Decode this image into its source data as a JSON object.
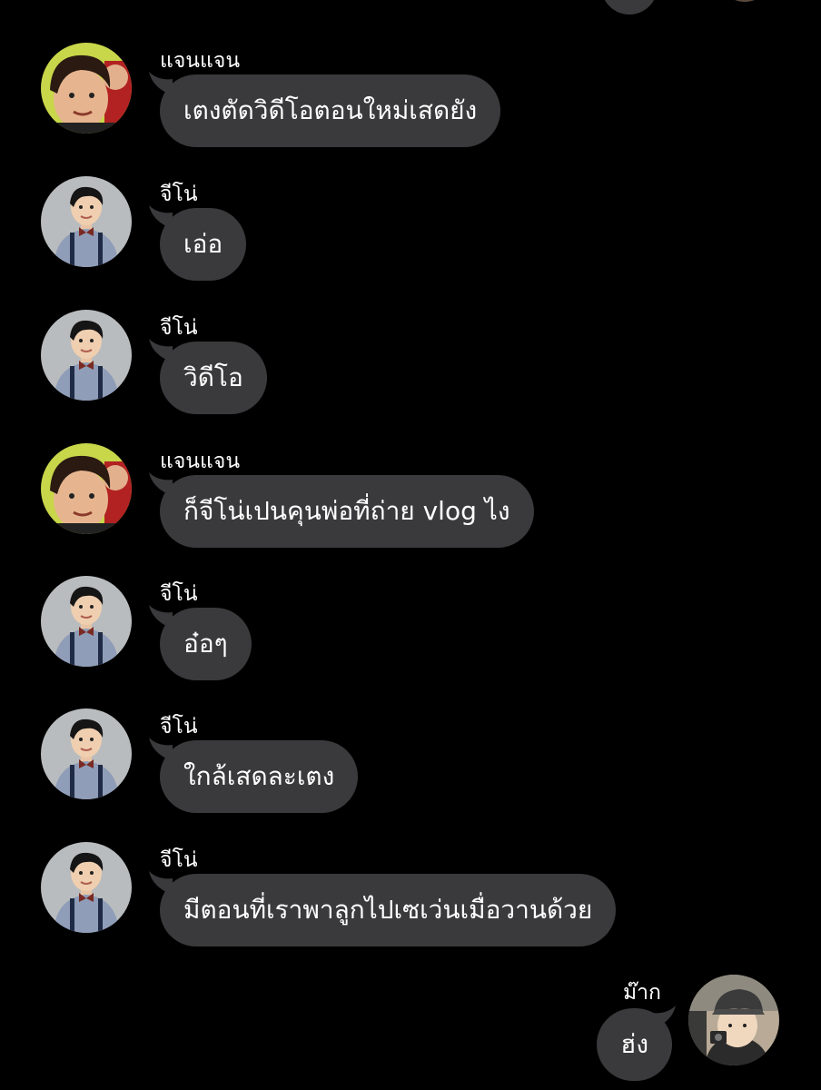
{
  "conversation": {
    "messages": [
      {
        "sender": "แจนแจน",
        "text": "เตงตัดวิดีโอตอนใหม่เสดยัง",
        "avatar": "avatar-janjan",
        "direction": "incoming"
      },
      {
        "sender": "จีโน่",
        "text": "เอ่อ",
        "avatar": "avatar-gino",
        "direction": "incoming"
      },
      {
        "sender": "จีโน่",
        "text": "วิดีโอ",
        "avatar": "avatar-gino",
        "direction": "incoming"
      },
      {
        "sender": "แจนแจน",
        "text": "ก็จีโน่เปนคุนพ่อที่ถ่าย vlog ไง",
        "avatar": "avatar-janjan",
        "direction": "incoming"
      },
      {
        "sender": "จีโน่",
        "text": "อ๋อๆ",
        "avatar": "avatar-gino",
        "direction": "incoming"
      },
      {
        "sender": "จีโน่",
        "text": "ใกล้เสดละเตง",
        "avatar": "avatar-gino",
        "direction": "incoming"
      },
      {
        "sender": "จีโน่",
        "text": "มีตอนที่เราพาลูกไปเซเว่นเมื่อวานด้วย",
        "avatar": "avatar-gino",
        "direction": "incoming"
      },
      {
        "sender": "ม๊าก",
        "text": "ฮ่ง",
        "avatar": "avatar-mark",
        "direction": "outgoing"
      }
    ]
  },
  "colors": {
    "background": "#000000",
    "bubble": "#3a3a3c",
    "text": "#ffffff"
  }
}
